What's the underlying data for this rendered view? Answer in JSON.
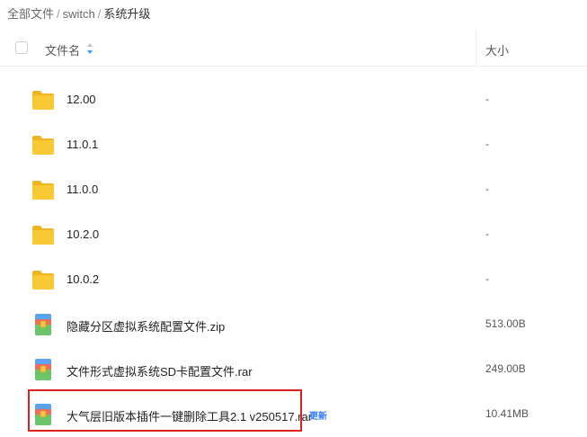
{
  "breadcrumb": {
    "items": [
      "全部文件",
      "switch",
      "系统升级"
    ],
    "separator": "/"
  },
  "header": {
    "name_label": "文件名",
    "size_label": "大小"
  },
  "files": [
    {
      "name": "12.00",
      "size": "-",
      "type": "folder-icon"
    },
    {
      "name": "11.0.1",
      "size": "-",
      "type": "folder-icon"
    },
    {
      "name": "11.0.0",
      "size": "-",
      "type": "folder-icon"
    },
    {
      "name": "10.2.0",
      "size": "-",
      "type": "folder-icon"
    },
    {
      "name": "10.0.2",
      "size": "-",
      "type": "folder-icon"
    },
    {
      "name": "隐藏分区虚拟系统配置文件.zip",
      "size": "513.00B",
      "type": "archive-icon"
    },
    {
      "name": "文件形式虚拟系统SD卡配置文件.rar",
      "size": "249.00B",
      "type": "archive-icon"
    },
    {
      "name": "大气层旧版本插件一键删除工具2.1 v250517.rar",
      "size": "10.41MB",
      "type": "archive-icon",
      "badge": "更新"
    }
  ],
  "colors": {
    "folder": "#f7c325",
    "highlight_border": "#e0201a",
    "badge": "#2f7bff"
  }
}
